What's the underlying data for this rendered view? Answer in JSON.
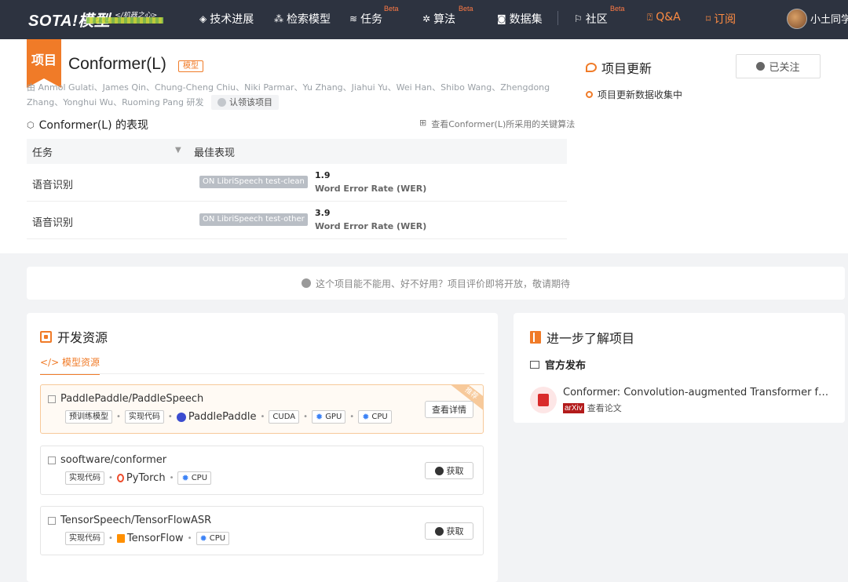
{
  "nav": {
    "logo": "SOTA!模型",
    "logo_sub": "</机器之心>",
    "items": [
      {
        "label": "技术进展",
        "icon": "diamond-icon",
        "beta": ""
      },
      {
        "label": "检索模型",
        "icon": "nodes-icon",
        "beta": ""
      },
      {
        "label": "任务",
        "icon": "layers-icon",
        "beta": "Beta"
      },
      {
        "label": "算法",
        "icon": "gear-icon",
        "beta": "Beta"
      },
      {
        "label": "数据集",
        "icon": "database-icon",
        "beta": ""
      },
      {
        "label": "社区",
        "icon": "flag-icon",
        "beta": "Beta"
      },
      {
        "label": "Q&A",
        "icon": "qa-icon",
        "beta": ""
      },
      {
        "label": "订阅",
        "icon": "subscribe-icon",
        "beta": ""
      }
    ],
    "user": "小土同学"
  },
  "project": {
    "ribbon": "项目",
    "title": "Conformer(L)",
    "tag": "模型",
    "authors": "由 Anmol Gulati、James Qin、Chung-Cheng Chiu、Niki Parmar、Yu Zhang、Jiahui Yu、Wei Han、Shibo Wang、Zhengdong Zhang、Yonghui Wu、Ruoming Pang 研发",
    "claim": "认领该项目",
    "perf_title": "Conformer(L) 的表现",
    "perf_link": "查看Conformer(L)所采用的关键算法",
    "table": {
      "headers": [
        "任务",
        "最佳表现"
      ],
      "rows": [
        {
          "task": "语音识别",
          "dataset": "ON LibriSpeech test-clean",
          "value": "1.9",
          "metric": "Word Error Rate (WER)"
        },
        {
          "task": "语音识别",
          "dataset": "ON LibriSpeech test-other",
          "value": "3.9",
          "metric": "Word Error Rate (WER)"
        }
      ]
    }
  },
  "updates": {
    "title": "项目更新",
    "follow": "已关注",
    "item": "项目更新数据收集中"
  },
  "notice": "这个项目能不能用、好不好用？项目评价即将开放，敬请期待",
  "dev": {
    "title": "开发资源",
    "tab": "</> 模型资源",
    "resources": [
      {
        "name": "PaddlePaddle/PaddleSpeech",
        "corner": "推荐",
        "tags": [
          "预训练模型",
          "实现代码"
        ],
        "framework": "PaddlePaddle",
        "extra": [
          "CUDA",
          "GPU",
          "CPU"
        ],
        "button": "查看详情"
      },
      {
        "name": "sooftware/conformer",
        "corner": "",
        "tags": [
          "实现代码"
        ],
        "framework": "PyTorch",
        "extra": [
          "CPU"
        ],
        "button": "获取"
      },
      {
        "name": "TensorSpeech/TensorFlowASR",
        "corner": "",
        "tags": [
          "实现代码"
        ],
        "framework": "TensorFlow",
        "extra": [
          "CPU"
        ],
        "button": "获取"
      }
    ]
  },
  "more": {
    "title": "进一步了解项目",
    "official": "官方发布",
    "paper_title": "Conformer: Convolution-augmented Transformer for Speech Recognition",
    "paper_source": "arXiv",
    "paper_link": "查看论文"
  },
  "colors": {
    "accent": "#f07b28",
    "nav_bg": "#2d3340",
    "beta": "#ff7a45"
  }
}
